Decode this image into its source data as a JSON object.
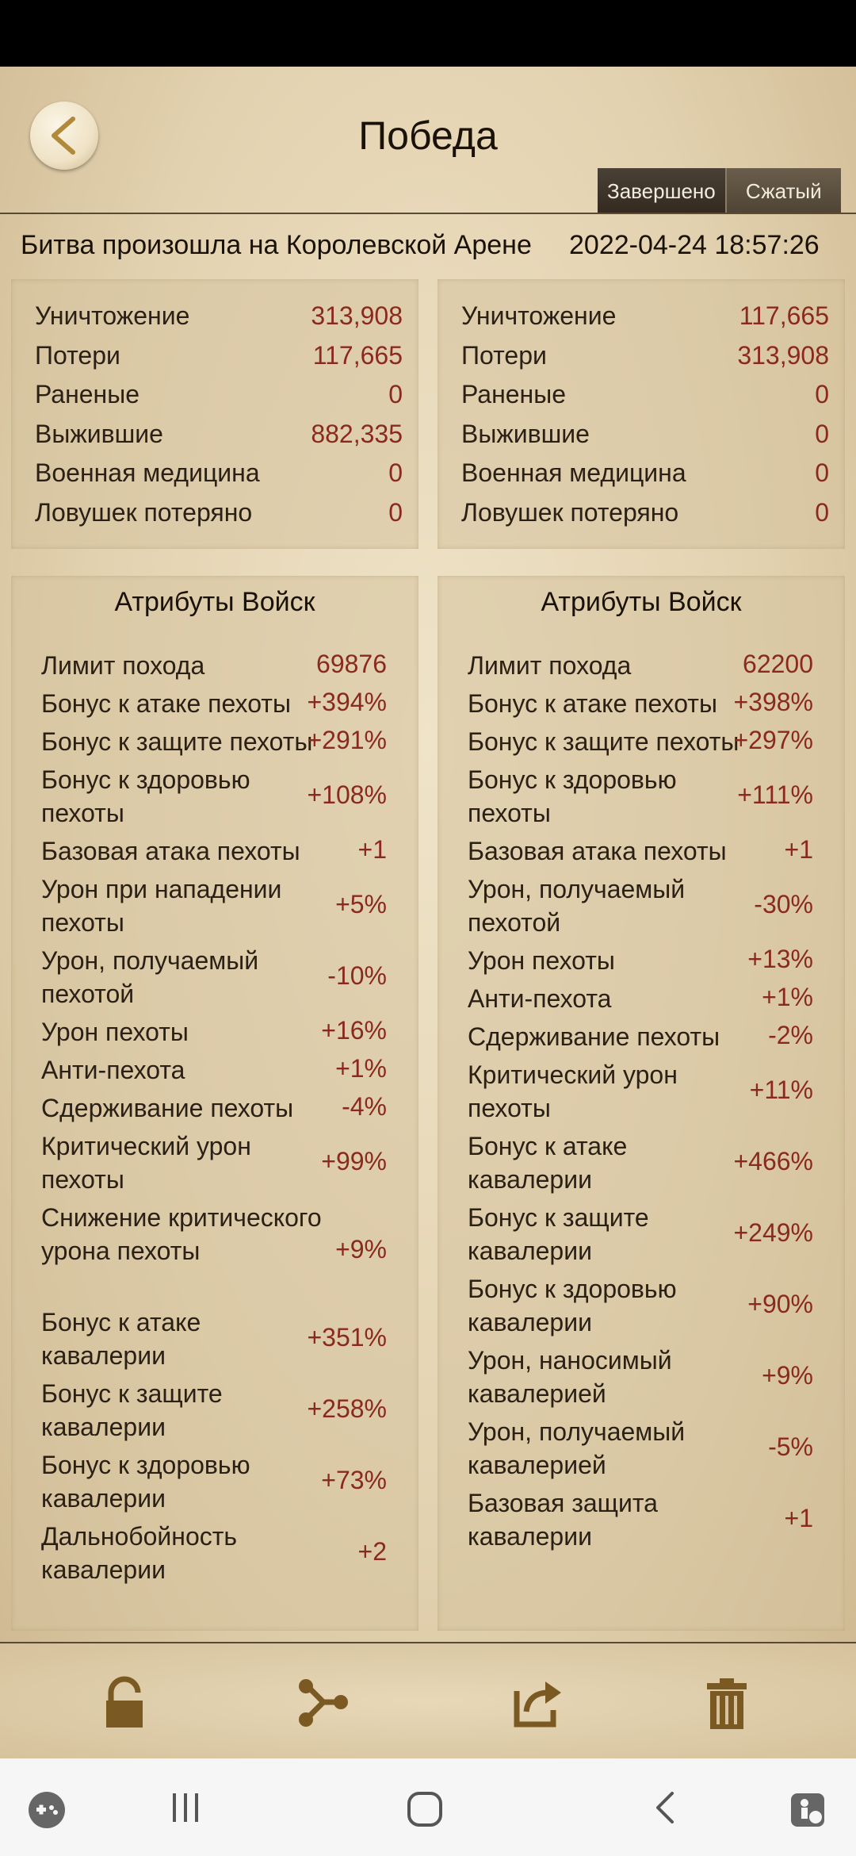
{
  "header": {
    "title": "Победа",
    "tabs": [
      "Завершено",
      "Сжатый"
    ]
  },
  "battle": {
    "location": "Битва произошла на Королевской Арене",
    "datetime": "2022-04-24  18:57:26"
  },
  "summary_left": [
    {
      "label": "Уничтожение",
      "value": "313,908"
    },
    {
      "label": "Потери",
      "value": "117,665"
    },
    {
      "label": "Раненые",
      "value": "0"
    },
    {
      "label": "Выжившие",
      "value": "882,335"
    },
    {
      "label": "Военная медицина",
      "value": "0"
    },
    {
      "label": "Ловушек потеряно",
      "value": "0"
    }
  ],
  "summary_right": [
    {
      "label": "Уничтожение",
      "value": "117,665"
    },
    {
      "label": "Потери",
      "value": "313,908"
    },
    {
      "label": "Раненые",
      "value": "0"
    },
    {
      "label": "Выжившие",
      "value": "0"
    },
    {
      "label": "Военная медицина",
      "value": "0"
    },
    {
      "label": "Ловушек потеряно",
      "value": "0"
    }
  ],
  "attributes_title": "Атрибуты Войск",
  "attrs_left": [
    {
      "label": "Лимит похода",
      "value": "69876"
    },
    {
      "label": "Бонус к атаке пехоты",
      "value": "+394%"
    },
    {
      "label": "Бонус к защите пехоты",
      "value": "+291%"
    },
    {
      "label": "Бонус к здоровью пехоты",
      "value": "+108%"
    },
    {
      "label": "Базовая атака пехоты",
      "value": "+1"
    },
    {
      "label": "Урон при нападении пехоты",
      "value": "+5%"
    },
    {
      "label": "Урон, получаемый пехотой",
      "value": "-10%"
    },
    {
      "label": "Урон пехоты",
      "value": "+16%"
    },
    {
      "label": "Анти-пехота",
      "value": "+1%"
    },
    {
      "label": "Сдерживание пехоты",
      "value": "-4%"
    },
    {
      "label": "Критический урон пехоты",
      "value": "+99%"
    },
    {
      "label": "Снижение критического урона пехоты",
      "value": "+9%"
    },
    {
      "label": "Бонус к атаке кавалерии",
      "value": "+351%"
    },
    {
      "label": "Бонус к защите кавалерии",
      "value": "+258%"
    },
    {
      "label": "Бонус к здоровью кавалерии",
      "value": "+73%"
    },
    {
      "label": "Дальнобойность кавалерии",
      "value": "+2"
    }
  ],
  "attrs_right": [
    {
      "label": "Лимит похода",
      "value": "62200"
    },
    {
      "label": "Бонус к атаке пехоты",
      "value": "+398%"
    },
    {
      "label": "Бонус к защите пехоты",
      "value": "+297%"
    },
    {
      "label": "Бонус к здоровью пехоты",
      "value": "+111%"
    },
    {
      "label": "Базовая атака пехоты",
      "value": "+1"
    },
    {
      "label": "Урон, получаемый пехотой",
      "value": "-30%"
    },
    {
      "label": "Урон пехоты",
      "value": "+13%"
    },
    {
      "label": "Анти-пехота",
      "value": "+1%"
    },
    {
      "label": "Сдерживание пехоты",
      "value": "-2%"
    },
    {
      "label": "Критический урон пехоты",
      "value": "+11%"
    },
    {
      "label": "Бонус к атаке кавалерии",
      "value": "+466%"
    },
    {
      "label": "Бонус к защите кавалерии",
      "value": "+249%"
    },
    {
      "label": "Бонус к здоровью кавалерии",
      "value": "+90%"
    },
    {
      "label": "Урон, наносимый кавалерией",
      "value": "+9%"
    },
    {
      "label": "Урон, получаемый кавалерией",
      "value": "-5%"
    },
    {
      "label": "Базовая защита кавалерии",
      "value": "+1"
    }
  ],
  "toolbar": [
    "lock-icon",
    "share-icon",
    "export-icon",
    "trash-icon"
  ],
  "colors": {
    "value_red": "#8a2a1e",
    "paper": "#e8d9bb",
    "icon_brown": "#7a5a22"
  }
}
